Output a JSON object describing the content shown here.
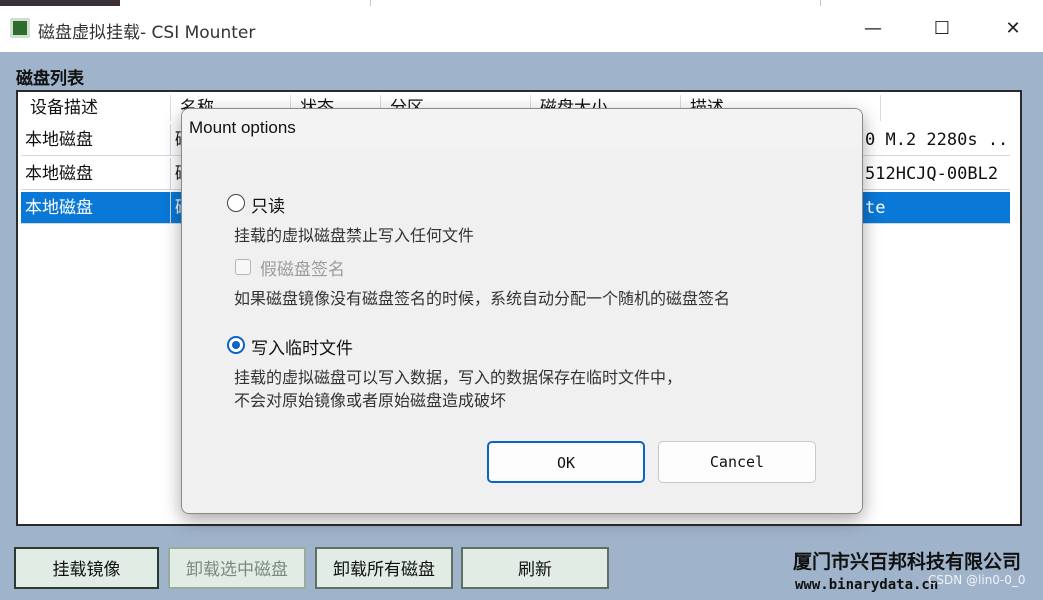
{
  "window": {
    "title": "磁盘虚拟挂载- CSI Mounter",
    "minimize_glyph": "—",
    "maximize_glyph": "☐",
    "close_glyph": "✕"
  },
  "disk_list": {
    "title": "磁盘列表",
    "columns": [
      "设备描述",
      "名称",
      "状态",
      "分区",
      "磁盘大小",
      "描述"
    ],
    "rows": [
      {
        "device": "本地磁盘",
        "name": "磁",
        "desc": "0  M.2 2280s ...",
        "selected": false
      },
      {
        "device": "本地磁盘",
        "name": "磁",
        "desc": "512HCJQ-00BL2",
        "selected": false
      },
      {
        "device": "本地磁盘",
        "name": "磁",
        "desc": "te",
        "selected": true
      }
    ]
  },
  "buttons": {
    "mount_image": "挂载镜像",
    "unmount_selected": "卸载选中磁盘",
    "unmount_all": "卸载所有磁盘",
    "refresh": "刷新"
  },
  "footer": {
    "company": "厦门市兴百邦科技有限公司",
    "website": "www.binarydata.cn",
    "watermark": "CSDN @lin0-0_0"
  },
  "dialog": {
    "title": "Mount options",
    "readonly": {
      "label": "只读",
      "checked": false,
      "description": "挂载的虚拟磁盘禁止写入任何文件"
    },
    "fake_signature": {
      "label": "假磁盘签名",
      "checked": false,
      "disabled": true,
      "description": "如果磁盘镜像没有磁盘签名的时候，系统自动分配一个随机的磁盘签名"
    },
    "write_temp": {
      "label": "写入临时文件",
      "checked": true,
      "description_line1": "挂载的虚拟磁盘可以写入数据，写入的数据保存在临时文件中，",
      "description_line2": "不会对原始镜像或者原始磁盘造成破坏"
    },
    "ok": "OK",
    "cancel": "Cancel"
  },
  "colors": {
    "selection": "#0a78d7",
    "accent": "#0a64c8",
    "background": "#9fb3cb"
  }
}
